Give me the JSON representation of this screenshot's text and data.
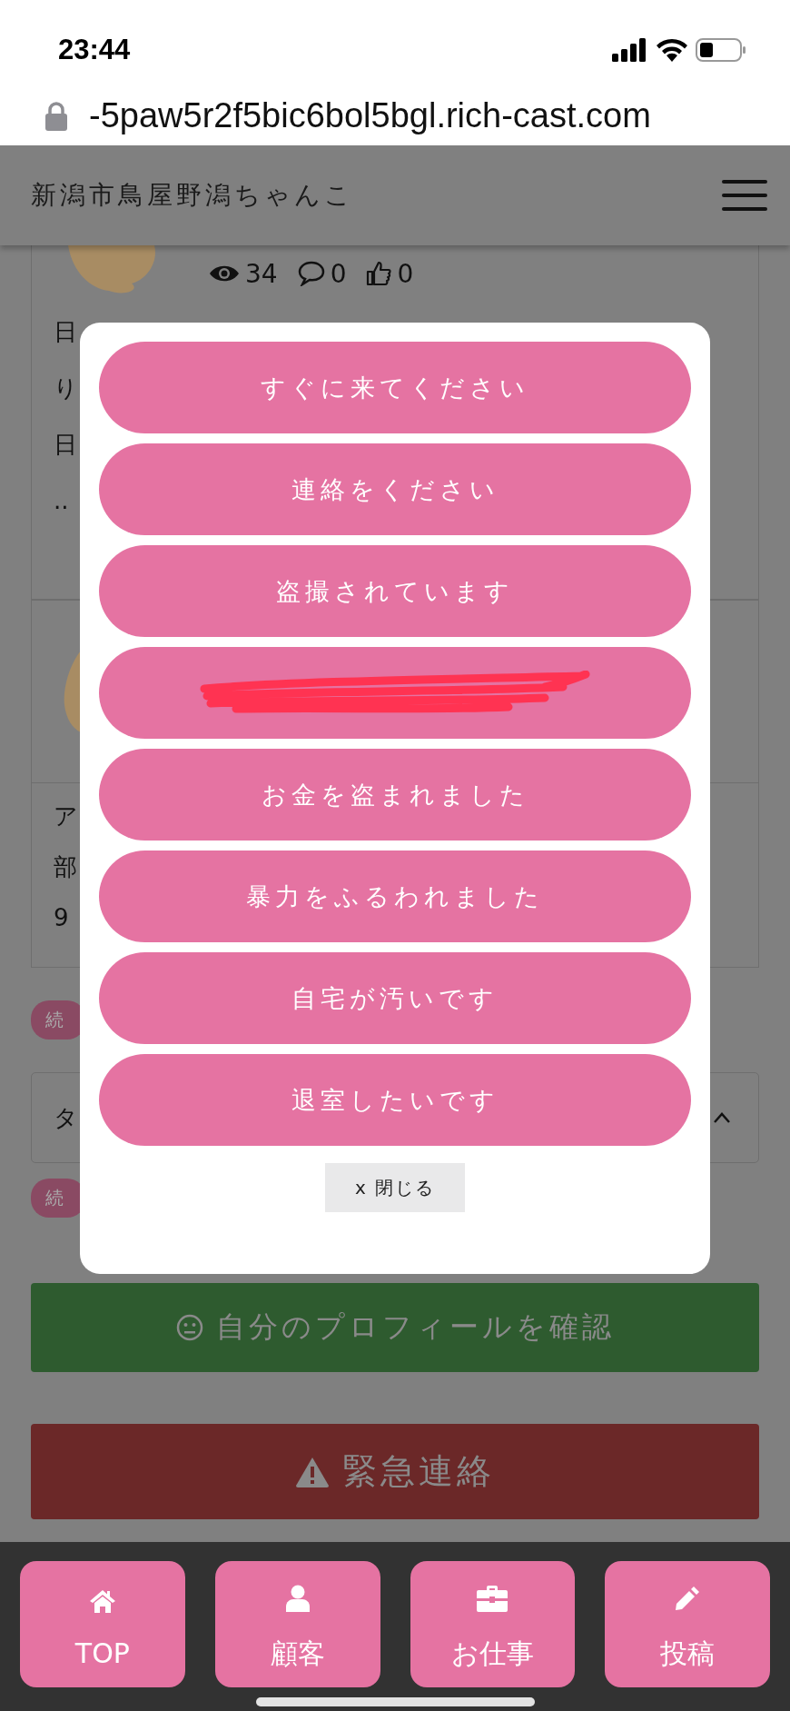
{
  "status_bar": {
    "time": "23:44"
  },
  "address_bar": {
    "url": "-5paw5r2f5bic6bol5bgl.rich-cast.com"
  },
  "header": {
    "title": "新潟市鳥屋野潟ちゃんこ"
  },
  "background": {
    "stats": [
      "34",
      "0",
      "0"
    ],
    "post_1_fragments": [
      "日",
      "り",
      "日",
      ".."
    ],
    "post_2_fragments": [
      "ア",
      "部",
      "9"
    ],
    "badges": [
      "続",
      "続"
    ],
    "panel_fragment": "タ",
    "profile_button": "自分のプロフィールを確認",
    "emergency_button": "緊急連絡"
  },
  "modal": {
    "options": [
      {
        "kind": "text",
        "label": "すぐに来てください"
      },
      {
        "kind": "text",
        "label": "連絡をください"
      },
      {
        "kind": "text",
        "label": "盗撮されています"
      },
      {
        "kind": "redacted"
      },
      {
        "kind": "text",
        "label": "お金を盗まれました"
      },
      {
        "kind": "text",
        "label": "暴力をふるわれました"
      },
      {
        "kind": "text",
        "label": "自宅が汚いです"
      },
      {
        "kind": "text",
        "label": "退室したいです"
      }
    ],
    "close_button": "x 閉じる"
  },
  "bottom_nav": [
    {
      "label": "TOP"
    },
    {
      "label": "顧客"
    },
    {
      "label": "お仕事"
    },
    {
      "label": "投稿"
    }
  ]
}
